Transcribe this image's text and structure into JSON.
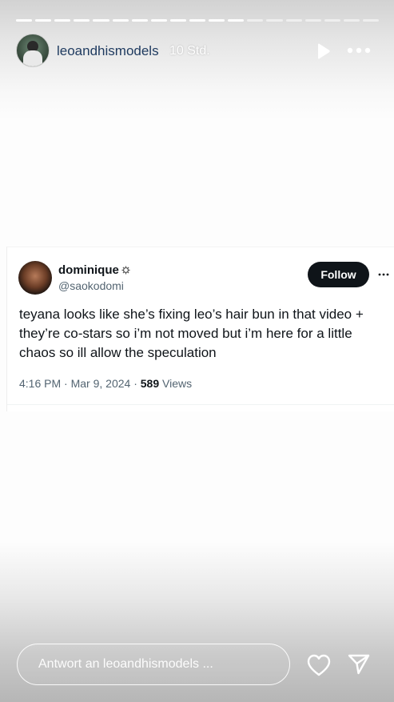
{
  "story": {
    "progress_total": 19,
    "progress_done": 12,
    "username": "leoandhismodels",
    "time": "10 Std.",
    "avatar_icon": "profile-photo",
    "play_icon": "play-icon",
    "more_icon": "more-horizontal-icon"
  },
  "tweet": {
    "name": "dominique",
    "badge_icon": "gear-icon",
    "handle": "@saokodomi",
    "follow_label": "Follow",
    "text": "teyana looks like she’s fixing leo’s hair bun in that video + they’re co-stars so i’m not moved but i’m here for a little chaos so ill allow the speculation",
    "time": "4:16 PM",
    "sep1": " · ",
    "date": "Mar 9, 2024",
    "sep2": " · ",
    "views_count": "589",
    "views_label": " Views"
  },
  "reply": {
    "placeholder": "Antwort an leoandhismodels ...",
    "heart_icon": "heart-icon",
    "send_icon": "send-icon"
  },
  "colors": {
    "username": "#1e3a5f",
    "follow_bg": "#0f1419",
    "muted_text": "#536471"
  }
}
